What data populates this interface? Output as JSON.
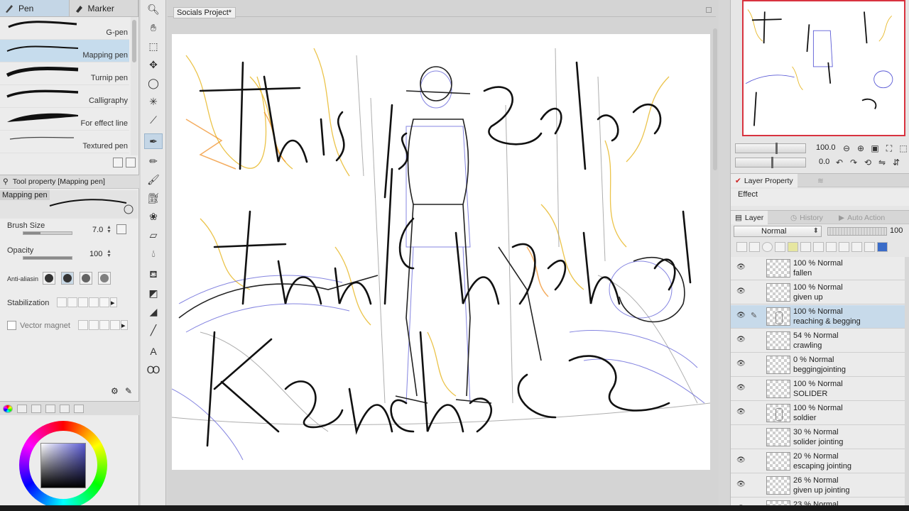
{
  "window": {
    "document_tab": "Socials Project*"
  },
  "brush_panel": {
    "tabs": [
      {
        "label": "Pen",
        "icon": "pen-icon",
        "active": true
      },
      {
        "label": "Marker",
        "icon": "marker-icon",
        "active": false
      }
    ],
    "brushes": [
      {
        "label": "G-pen"
      },
      {
        "label": "Mapping pen",
        "selected": true
      },
      {
        "label": "Turnip pen"
      },
      {
        "label": "Calligraphy"
      },
      {
        "label": "For effect line"
      },
      {
        "label": "Textured pen"
      }
    ]
  },
  "tool_property": {
    "header": "Tool property [Mapping pen]",
    "preview_name": "Mapping pen",
    "brush_size_label": "Brush Size",
    "brush_size_value": "7.0",
    "brush_size_fraction": 0.35,
    "opacity_label": "Opacity",
    "opacity_value": "100",
    "opacity_fraction": 1.0,
    "anti_aliasing_label": "Anti-aliasin",
    "stabilization_label": "Stabilization",
    "vector_magnet_label": "Vector magnet"
  },
  "navigator": {
    "zoom_value": "100.0",
    "rotate_value": "0.0"
  },
  "panels": {
    "layer_property_tab": "Layer Property",
    "effect_label": "Effect",
    "layer_tab": "Layer",
    "history_tab": "History",
    "auto_action_tab": "Auto Action",
    "blend_mode": "Normal",
    "layer_opacity": "100"
  },
  "layers": [
    {
      "mode": "100 % Normal",
      "name": "fallen",
      "visible": true
    },
    {
      "mode": "100 % Normal",
      "name": "given up",
      "visible": true
    },
    {
      "mode": "100 % Normal",
      "name": "reaching & begging",
      "visible": true,
      "selected": true
    },
    {
      "mode": "54 % Normal",
      "name": "crawling",
      "visible": true
    },
    {
      "mode": "0 % Normal",
      "name": "beggingjointing",
      "visible": true
    },
    {
      "mode": "100 % Normal",
      "name": "SOLIDER",
      "visible": true
    },
    {
      "mode": "100 % Normal",
      "name": "soldier",
      "visible": true
    },
    {
      "mode": "30 % Normal",
      "name": "solider jointing",
      "visible": false
    },
    {
      "mode": "20 % Normal",
      "name": "escaping jointing",
      "visible": true
    },
    {
      "mode": "26 % Normal",
      "name": "given up jointing",
      "visible": true
    },
    {
      "mode": "23 % Normal",
      "name": "",
      "visible": true
    }
  ],
  "colors": {
    "accent_blue": "#c4d6e6",
    "navigator_border": "#d8333f",
    "main_color": "#000000",
    "sub_color": "#d8b7b7"
  }
}
